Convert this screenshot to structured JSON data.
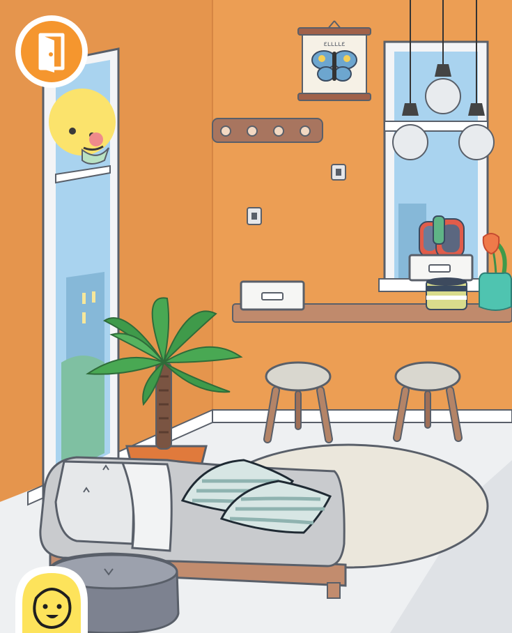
{
  "scene": {
    "colors": {
      "wall": "#ec9e54",
      "wall_side": "#e8974f",
      "floor": "#eef0f2",
      "outline": "#595f69",
      "accent_orange": "#f5962e",
      "character_yellow": "#fde35b",
      "plant_green": "#3f9a4a"
    }
  },
  "hud": {
    "exit_button": {
      "icon": "door-exit-icon",
      "color": "#f5962e"
    },
    "character_button": {
      "icon": "character-face-icon",
      "color": "#fde35b"
    }
  },
  "poster": {
    "caption": "ɛʟʟʟʟɛ",
    "subject": "butterfly"
  }
}
